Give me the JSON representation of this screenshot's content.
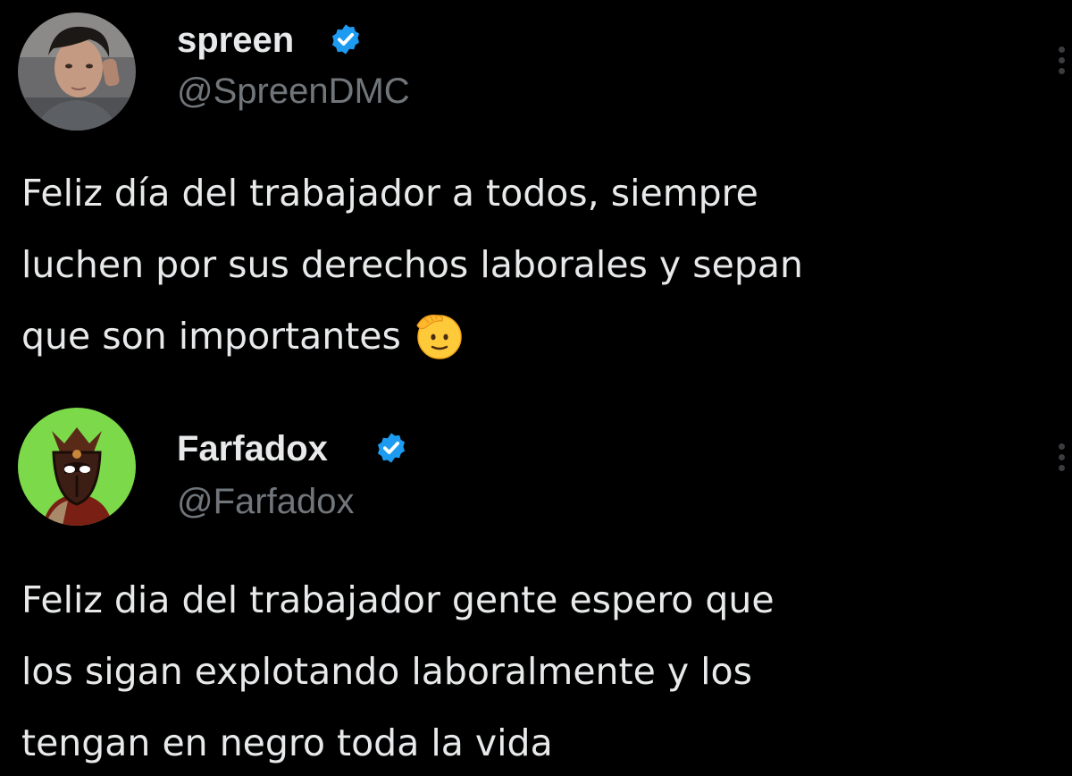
{
  "tweets": [
    {
      "display_name": "spreen",
      "handle": "@SpreenDMC",
      "verified": true,
      "avatar_icon": "profile-photo-person",
      "text_lines": [
        "Feliz día del trabajador a todos, siempre",
        "luchen por sus derechos laborales y sepan",
        "que son importantes"
      ],
      "emoji": "saluting-face-emoji"
    },
    {
      "display_name": "Farfadox",
      "handle": "@Farfadox",
      "verified": true,
      "avatar_icon": "profile-avatar-armored-knight",
      "text_lines": [
        "Feliz dia del trabajador gente espero que",
        "los sigan explotando laboralmente y los",
        "tengan en negro toda la vida"
      ]
    }
  ],
  "colors": {
    "background": "#000000",
    "text": "#e7e9ea",
    "handle": "#71767b",
    "verified_badge": "#1d9bf0",
    "avatar2_ring": "#7cd94a"
  }
}
